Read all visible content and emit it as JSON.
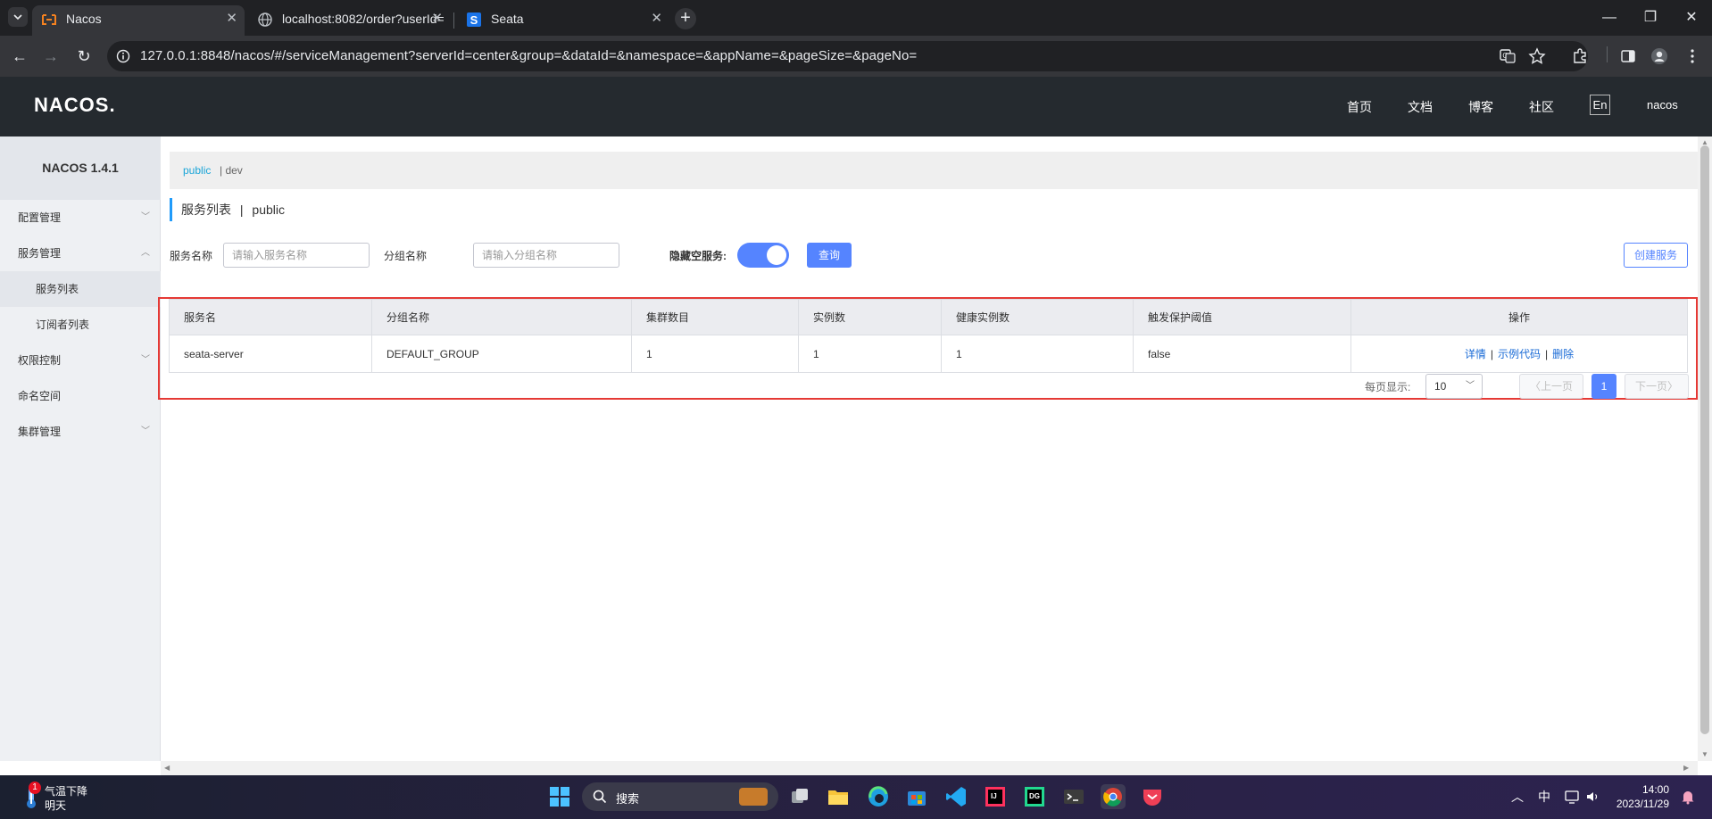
{
  "browser": {
    "tabs": [
      {
        "title": "Nacos",
        "active": true
      },
      {
        "title": "localhost:8082/order?userId=",
        "active": false
      },
      {
        "title": "Seata",
        "active": false
      }
    ],
    "url": "127.0.0.1:8848/nacos/#/serviceManagement?serverId=center&group=&dataId=&namespace=&appName=&pageSize=&pageNo="
  },
  "header": {
    "logo": "NACOS.",
    "links": [
      "首页",
      "文档",
      "博客",
      "社区"
    ],
    "lang": "En",
    "user": "nacos"
  },
  "sidebar": {
    "title": "NACOS 1.4.1",
    "items": [
      {
        "label": "配置管理",
        "arrow": "﹀"
      },
      {
        "label": "服务管理",
        "arrow": "︿"
      },
      {
        "label": "服务列表"
      },
      {
        "label": "订阅者列表"
      },
      {
        "label": "权限控制",
        "arrow": "﹀"
      },
      {
        "label": "命名空间"
      },
      {
        "label": "集群管理",
        "arrow": "﹀"
      }
    ]
  },
  "main": {
    "namespaces": {
      "current": "public",
      "other": "| dev"
    },
    "title": "服务列表",
    "title_sep": "|",
    "title_ns": "public",
    "filters": {
      "service_name_label": "服务名称",
      "service_name_placeholder": "请输入服务名称",
      "group_name_label": "分组名称",
      "group_name_placeholder": "请输入分组名称",
      "hide_empty_label": "隐藏空服务:",
      "query_button": "查询",
      "create_button": "创建服务"
    },
    "table": {
      "headers": [
        "服务名",
        "分组名称",
        "集群数目",
        "实例数",
        "健康实例数",
        "触发保护阈值",
        "操作"
      ],
      "rows": [
        {
          "service": "seata-server",
          "group": "DEFAULT_GROUP",
          "clusters": "1",
          "instances": "1",
          "healthy": "1",
          "threshold": "false",
          "actions": [
            "详情",
            "示例代码",
            "删除"
          ]
        }
      ]
    },
    "pagination": {
      "per_page_label": "每页显示:",
      "page_size": "10",
      "prev": "上一页",
      "current_page": "1",
      "next": "下一页"
    }
  },
  "taskbar": {
    "weather_badge": "1",
    "weather_line1": "气温下降",
    "weather_line2": "明天",
    "search": "搜索",
    "ime": "中",
    "time": "14:00",
    "date": "2023/11/29"
  }
}
